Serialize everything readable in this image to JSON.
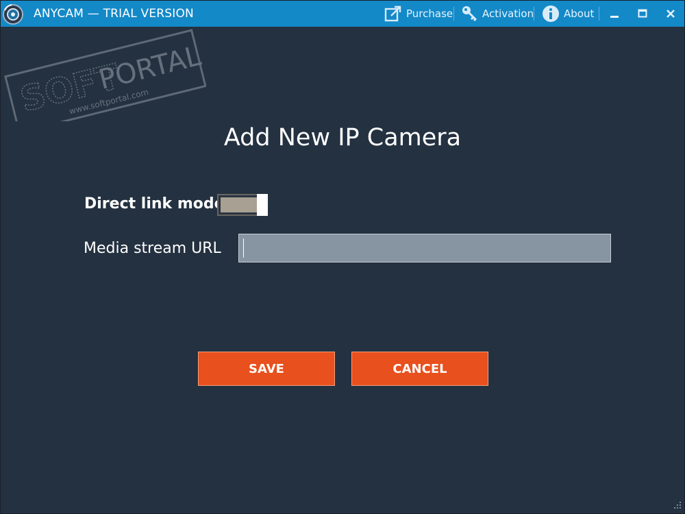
{
  "window": {
    "title": "ANYCAM — TRIAL VERSION"
  },
  "toolbar": {
    "purchase_label": "Purchase",
    "activation_label": "Activation",
    "about_label": "About",
    "purchase_icon": "external-link-icon",
    "activation_icon": "key-icon",
    "about_icon": "info-icon"
  },
  "watermark": {
    "brand_left": "SOFT",
    "brand_right": "PORTAL",
    "site": "www.softportal.com"
  },
  "dialog": {
    "title": "Add New IP Camera",
    "direct_link_label": "Direct link mode",
    "direct_link_enabled": true,
    "media_url_label": "Media stream URL",
    "media_url_value": "",
    "media_url_placeholder": "",
    "save_label": "SAVE",
    "cancel_label": "CANCEL"
  },
  "colors": {
    "titlebar": "#1489c8",
    "background": "#243140",
    "accent_button": "#e8501d",
    "input_background": "#8794a1"
  }
}
